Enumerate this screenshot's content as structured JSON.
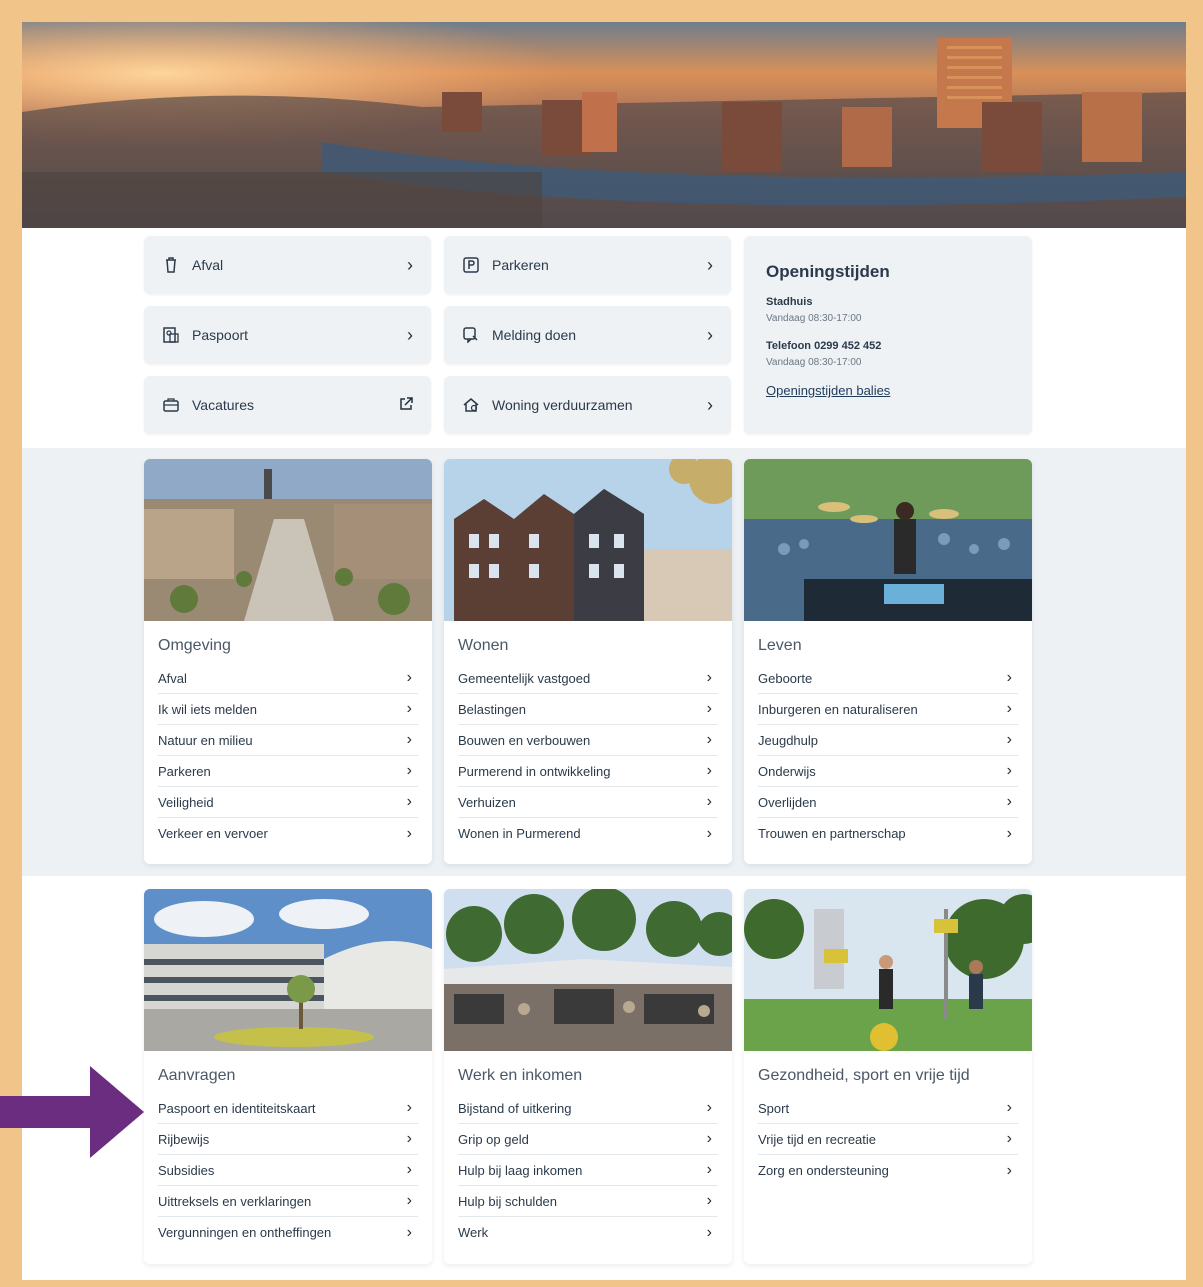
{
  "quick_links": [
    {
      "label": "Afval",
      "icon": "trash-icon",
      "trail": "chevron-right-icon"
    },
    {
      "label": "Parkeren",
      "icon": "parking-icon",
      "trail": "chevron-right-icon"
    },
    {
      "label": "Paspoort",
      "icon": "passport-icon",
      "trail": "chevron-right-icon"
    },
    {
      "label": "Melding doen",
      "icon": "report-icon",
      "trail": "chevron-right-icon"
    },
    {
      "label": "Vacatures",
      "icon": "briefcase-icon",
      "trail": "external-link-icon"
    },
    {
      "label": "Woning verduurzamen",
      "icon": "house-eco-icon",
      "trail": "chevron-right-icon"
    }
  ],
  "hours": {
    "title": "Openingstijden",
    "stadhuis_label": "Stadhuis",
    "stadhuis_time": "Vandaag 08:30-17:00",
    "phone_label": "Telefoon 0299 452 452",
    "phone_time": "Vandaag 08:30-17:00",
    "link": "Openingstijden balies"
  },
  "cards": [
    {
      "title": "Omgeving",
      "items": [
        "Afval",
        "Ik wil iets melden",
        "Natuur en milieu",
        "Parkeren",
        "Veiligheid",
        "Verkeer en vervoer"
      ]
    },
    {
      "title": "Wonen",
      "items": [
        "Gemeentelijk vastgoed",
        "Belastingen",
        "Bouwen en verbouwen",
        "Purmerend in ontwikkeling",
        "Verhuizen",
        "Wonen in Purmerend"
      ]
    },
    {
      "title": "Leven",
      "items": [
        "Geboorte",
        "Inburgeren en naturaliseren",
        "Jeugdhulp",
        "Onderwijs",
        "Overlijden",
        "Trouwen en partnerschap"
      ]
    },
    {
      "title": "Aanvragen",
      "items": [
        "Paspoort en identiteitskaart",
        "Rijbewijs",
        "Subsidies",
        "Uittreksels en verklaringen",
        "Vergunningen en ontheffingen"
      ]
    },
    {
      "title": "Werk en inkomen",
      "items": [
        "Bijstand of uitkering",
        "Grip op geld",
        "Hulp bij laag inkomen",
        "Hulp bij schulden",
        "Werk"
      ]
    },
    {
      "title": "Gezondheid, sport en vrije tijd",
      "items": [
        "Sport",
        "Vrije tijd en recreatie",
        "Zorg en ondersteuning"
      ]
    }
  ],
  "colors": {
    "frame_border": "#f1c48a",
    "annotation_arrow": "#6a2d80",
    "band_background": "#edf1f4"
  }
}
